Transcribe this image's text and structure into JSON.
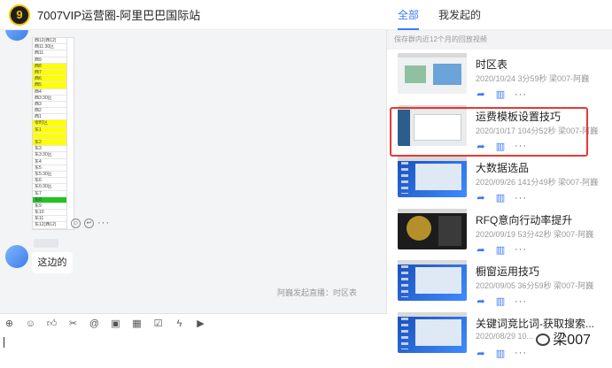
{
  "chat": {
    "group_title": "7007VIP运营圈-阿里巴巴国际站",
    "group_avatar_glyph": "9",
    "sheet_rows": [
      {
        "text": "西12(西12)",
        "hl": ""
      },
      {
        "text": "西11:30区",
        "hl": ""
      },
      {
        "text": "西11",
        "hl": ""
      },
      {
        "text": "西9",
        "hl": ""
      },
      {
        "text": "西8",
        "hl": "y"
      },
      {
        "text": "西7",
        "hl": "y"
      },
      {
        "text": "西6",
        "hl": "y"
      },
      {
        "text": "西5",
        "hl": "y"
      },
      {
        "text": "西4",
        "hl": ""
      },
      {
        "text": "西3:30区",
        "hl": ""
      },
      {
        "text": "西3",
        "hl": ""
      },
      {
        "text": "西2",
        "hl": ""
      },
      {
        "text": "西1",
        "hl": ""
      },
      {
        "text": "零时区",
        "hl": "y"
      },
      {
        "text": "东1",
        "hl": "y"
      },
      {
        "text": "",
        "hl": "y"
      },
      {
        "text": "东2",
        "hl": "y"
      },
      {
        "text": "东3",
        "hl": ""
      },
      {
        "text": "东3:30区",
        "hl": ""
      },
      {
        "text": "东4",
        "hl": ""
      },
      {
        "text": "东5",
        "hl": ""
      },
      {
        "text": "东5:30区",
        "hl": ""
      },
      {
        "text": "东6",
        "hl": ""
      },
      {
        "text": "东6:30区",
        "hl": ""
      },
      {
        "text": "东7",
        "hl": ""
      },
      {
        "text": "东8",
        "hl": "g"
      },
      {
        "text": "东9",
        "hl": ""
      },
      {
        "text": "东10",
        "hl": ""
      },
      {
        "text": "东11",
        "hl": ""
      },
      {
        "text": "东12(西12)",
        "hl": ""
      }
    ],
    "message_text": "这边的",
    "live_notice": "阿巍发起直播：时区表",
    "toolbar_icons": [
      "gif-icon",
      "emoji-icon",
      "thumbs-up-icon",
      "scissors-icon",
      "at-icon",
      "image-icon",
      "calendar-icon",
      "checkbox-icon",
      "lightning-icon",
      "video-icon"
    ]
  },
  "videos": {
    "tabs": [
      "全部",
      "我发起的"
    ],
    "active_tab": 0,
    "notice": "保存群内近12个月的回放视频",
    "items": [
      {
        "title": "时区表",
        "meta": "2020/10/24 3分59秒 梁007-阿巍",
        "thumb": "t-light"
      },
      {
        "title": "运费模板设置技巧",
        "meta": "2020/10/17 104分52秒 梁007-阿巍",
        "thumb": "t-ui"
      },
      {
        "title": "大数据选品",
        "meta": "2020/09/26 141分49秒 梁007-阿巍",
        "thumb": "t-blue"
      },
      {
        "title": "RFQ意向行动率提升",
        "meta": "2020/09/19 53分42秒 梁007-阿巍",
        "thumb": "t-dark"
      },
      {
        "title": "橱窗运用技巧",
        "meta": "2020/09/05 36分59秒 梁007-阿巍",
        "thumb": "t-blue"
      },
      {
        "title": "关键词竞比词-获取搜索...",
        "meta": "2020/08/29 10...",
        "thumb": "t-blue"
      }
    ],
    "highlight_color": "#e53935",
    "accent_color": "#3d7bf7"
  },
  "watermark": "梁007"
}
